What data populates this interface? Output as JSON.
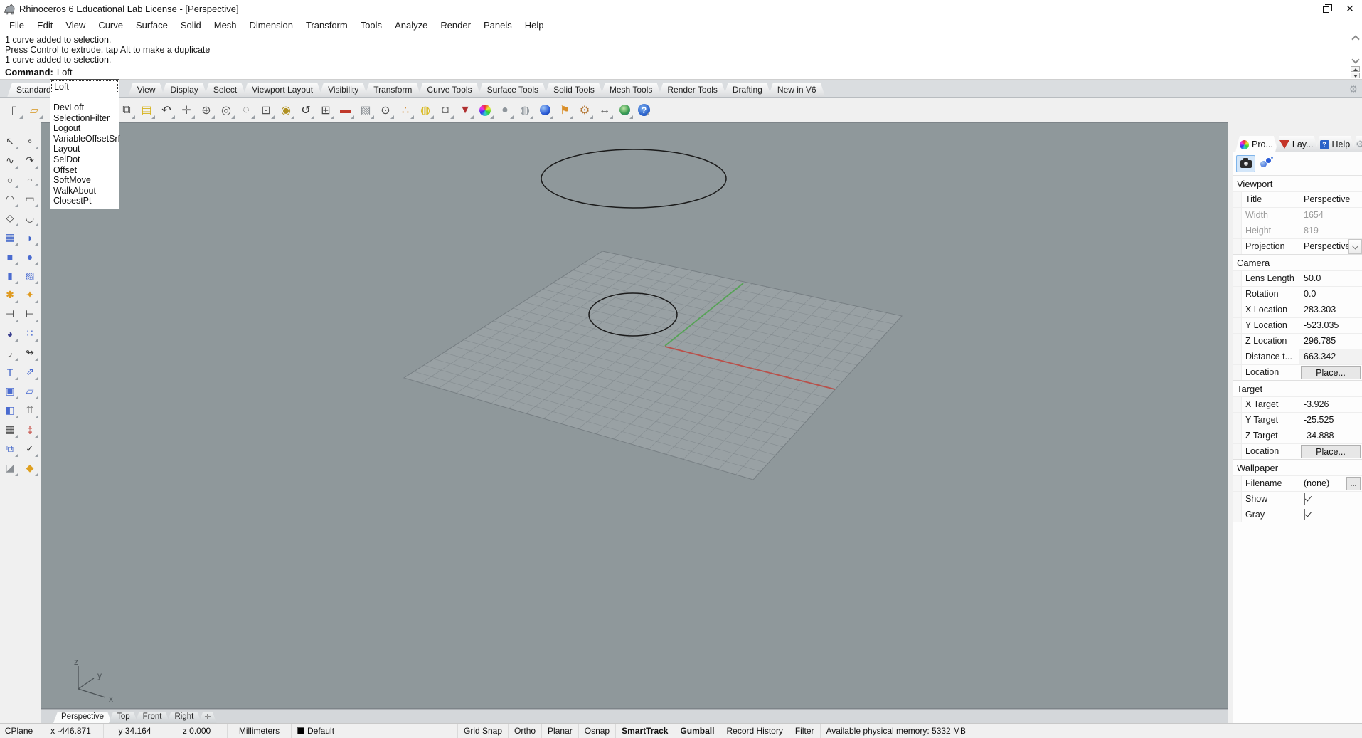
{
  "window": {
    "title": "Rhinoceros 6 Educational Lab License - [Perspective]"
  },
  "menu": {
    "items": [
      "File",
      "Edit",
      "View",
      "Curve",
      "Surface",
      "Solid",
      "Mesh",
      "Dimension",
      "Transform",
      "Tools",
      "Analyze",
      "Render",
      "Panels",
      "Help"
    ]
  },
  "command": {
    "history": [
      "1 curve added to selection.",
      "Press Control to extrude, tap Alt to make a duplicate",
      "1 curve added to selection."
    ],
    "prompt_label": "Command:",
    "prompt_value": "Loft"
  },
  "autocomplete": {
    "selected": "Loft",
    "items": [
      "DevLoft",
      "SelectionFilter",
      "Logout",
      "VariableOffsetSrf",
      "Layout",
      "SelDot",
      "Offset",
      "SoftMove",
      "WalkAbout",
      "ClosestPt"
    ]
  },
  "ribbon": {
    "first": "Standard",
    "tabs": [
      "View",
      "Display",
      "Select",
      "Viewport Layout",
      "Visibility",
      "Transform",
      "Curve Tools",
      "Surface Tools",
      "Solid Tools",
      "Mesh Tools",
      "Render Tools",
      "Drafting",
      "New in V6"
    ]
  },
  "main_toolbar": {
    "left_icons": [
      {
        "name": "new-file-icon",
        "glyph": "▯",
        "color": "#555"
      },
      {
        "name": "open-file-icon",
        "glyph": "▱",
        "color": "#d9a23a"
      }
    ],
    "icons": [
      {
        "name": "copy-icon",
        "glyph": "⧉",
        "color": "#555"
      },
      {
        "name": "paste-icon",
        "glyph": "▤",
        "color": "#d6b21c"
      },
      {
        "name": "undo-icon",
        "glyph": "↶",
        "color": "#333"
      },
      {
        "name": "pan-icon",
        "glyph": "✛",
        "color": "#555"
      },
      {
        "name": "rotate-view-icon",
        "glyph": "⊕",
        "color": "#555"
      },
      {
        "name": "zoom-extents-icon",
        "glyph": "◎",
        "color": "#555"
      },
      {
        "name": "zoom-dynamic-icon",
        "glyph": "◌",
        "color": "#555"
      },
      {
        "name": "zoom-window-icon",
        "glyph": "⊡",
        "color": "#555"
      },
      {
        "name": "zoom-selected-icon",
        "glyph": "◉",
        "color": "#b09020"
      },
      {
        "name": "undo-view-change-icon",
        "glyph": "↺",
        "color": "#333"
      },
      {
        "name": "viewport-layout-icon",
        "glyph": "⊞",
        "color": "#444"
      },
      {
        "name": "display-mode-icon",
        "glyph": "▬",
        "color": "#c0392b"
      },
      {
        "name": "surface-analysis-icon",
        "glyph": "▧",
        "color": "#8a8f94"
      },
      {
        "name": "radius-measure-icon",
        "glyph": "⊙",
        "color": "#555"
      },
      {
        "name": "object-snap-icon",
        "glyph": "∴",
        "color": "#d08020"
      },
      {
        "name": "lamp-icon",
        "glyph": "◍",
        "color": "#d8b81c"
      },
      {
        "name": "lock-icon",
        "glyph": "◘",
        "color": "#777"
      },
      {
        "name": "render-icon",
        "glyph": "▼",
        "color": "#b03030"
      },
      {
        "name": "color-wheel-icon",
        "glyph": "",
        "cls": "colorwheel"
      },
      {
        "name": "shaded-sphere-icon",
        "glyph": "●",
        "color": "#8f969c"
      },
      {
        "name": "ghosted-sphere-icon",
        "glyph": "◍",
        "color": "#8f969c"
      },
      {
        "name": "rendered-sphere-icon",
        "glyph": "",
        "cls": "bluesphere"
      },
      {
        "name": "flag-icon",
        "glyph": "⚑",
        "color": "#d98f2a"
      },
      {
        "name": "options-gears-icon",
        "glyph": "⚙",
        "color": "#b06f28"
      },
      {
        "name": "dimension-icon",
        "glyph": "↔",
        "color": "#444"
      },
      {
        "name": "earth-icon",
        "glyph": "",
        "cls": "earthico"
      },
      {
        "name": "help-icon",
        "glyph": "?",
        "cls": "helpico"
      }
    ]
  },
  "side_toolbar": {
    "icons": [
      {
        "name": "pointer-tool-icon",
        "glyph": "↖",
        "color": "#444"
      },
      {
        "name": "point-tool-icon",
        "glyph": "∘",
        "color": "#444"
      },
      {
        "name": "curve-points-tool-icon",
        "glyph": "∿",
        "color": "#444"
      },
      {
        "name": "curve-handles-tool-icon",
        "glyph": "↷",
        "color": "#444"
      },
      {
        "name": "circle-tool-icon",
        "glyph": "○",
        "color": "#444"
      },
      {
        "name": "ellipse-tool-icon",
        "glyph": "○",
        "color": "#444",
        "cls": "squish"
      },
      {
        "name": "arc-tool-icon",
        "glyph": "◠",
        "color": "#444"
      },
      {
        "name": "rectangle-tool-icon",
        "glyph": "▭",
        "color": "#444"
      },
      {
        "name": "polygon-tool-icon",
        "glyph": "◇",
        "color": "#444"
      },
      {
        "name": "blend-curve-tool-icon",
        "glyph": "◡",
        "color": "#444"
      },
      {
        "name": "surface-points-tool-icon",
        "glyph": "▦",
        "color": "#3f64c8"
      },
      {
        "name": "patch-surface-tool-icon",
        "glyph": "◗",
        "color": "#3f64c8"
      },
      {
        "name": "box-tool-icon",
        "glyph": "■",
        "color": "#4a6bd0"
      },
      {
        "name": "sphere-tool-icon",
        "glyph": "●",
        "color": "#4a6bd0"
      },
      {
        "name": "cylinder-tool-icon",
        "glyph": "▮",
        "color": "#4a6bd0"
      },
      {
        "name": "surface-grid-tool-icon",
        "glyph": "▨",
        "color": "#4a6bd0"
      },
      {
        "name": "boolean-tool-icon",
        "glyph": "✱",
        "color": "#df9a20"
      },
      {
        "name": "explode-tool-icon",
        "glyph": "✦",
        "color": "#df9a20"
      },
      {
        "name": "trim-tool-icon",
        "glyph": "⊣",
        "color": "#444"
      },
      {
        "name": "split-tool-icon",
        "glyph": "⊢",
        "color": "#444"
      },
      {
        "name": "color-tool-icon",
        "glyph": "◕",
        "color": "#3a3f8f"
      },
      {
        "name": "point-set-tool-icon",
        "glyph": "∷",
        "color": "#4a6bd0"
      },
      {
        "name": "fillet-tool-icon",
        "glyph": "◞",
        "color": "#444"
      },
      {
        "name": "continuity-tool-icon",
        "glyph": "↬",
        "color": "#444"
      },
      {
        "name": "text-tool-icon",
        "glyph": "T",
        "color": "#3f64c8"
      },
      {
        "name": "scale-tool-icon",
        "glyph": "⇗",
        "color": "#4a6bd0"
      },
      {
        "name": "arrange-tool-icon",
        "glyph": "▣",
        "color": "#4a6bd0"
      },
      {
        "name": "align-tool-icon",
        "glyph": "▱",
        "color": "#4a6bd0"
      },
      {
        "name": "save-tool-icon",
        "glyph": "◧",
        "color": "#4a6bd0"
      },
      {
        "name": "extrude-tool-icon",
        "glyph": "⇈",
        "color": "#888"
      },
      {
        "name": "array-tool-icon",
        "glyph": "▦",
        "color": "#444"
      },
      {
        "name": "section-tool-icon",
        "glyph": "‡",
        "color": "#c23b32"
      },
      {
        "name": "offset-copy-tool-icon",
        "glyph": "⧉",
        "color": "#3f64c8"
      },
      {
        "name": "check-tool-icon",
        "glyph": "✓",
        "color": "#222"
      },
      {
        "name": "solid-tools-icon",
        "glyph": "◪",
        "color": "#8a8f94"
      },
      {
        "name": "pyramid-tool-icon",
        "glyph": "◆",
        "color": "#dfa020"
      }
    ]
  },
  "viewport": {
    "colors": {
      "bg": "#8f989b",
      "grid_line": "#6f777c",
      "x_axis": "#b9504a",
      "y_axis": "#57a257",
      "curve": "#1b1b1b",
      "gnomon": "#4c5357"
    },
    "axis": {
      "x": "x",
      "y": "y",
      "z": "z"
    }
  },
  "viewport_tabs": {
    "items": [
      {
        "label": "Perspective",
        "active": true,
        "name": "viewport-tab-perspective"
      },
      {
        "label": "Top",
        "name": "viewport-tab-top"
      },
      {
        "label": "Front",
        "name": "viewport-tab-front"
      },
      {
        "label": "Right",
        "name": "viewport-tab-right"
      }
    ],
    "add_label": "✛"
  },
  "panel": {
    "tabs": [
      {
        "label": "Pro...",
        "name": "panel-tab-properties",
        "cls": "pt-prop",
        "active": true
      },
      {
        "label": "Lay...",
        "name": "panel-tab-layers",
        "cls": "pt-lay"
      },
      {
        "label": "Help",
        "name": "panel-tab-help",
        "cls": "pt-help",
        "icon_glyph": "?"
      }
    ],
    "viewport": {
      "title": "Viewport",
      "rows": {
        "title": {
          "label": "Title",
          "value": "Perspective"
        },
        "width": {
          "label": "Width",
          "value": "1654"
        },
        "height": {
          "label": "Height",
          "value": "819"
        },
        "projection": {
          "label": "Projection",
          "value": "Perspective"
        }
      }
    },
    "camera": {
      "title": "Camera",
      "rows": {
        "lens": {
          "label": "Lens Length",
          "value": "50.0"
        },
        "rotation": {
          "label": "Rotation",
          "value": "0.0"
        },
        "xloc": {
          "label": "X Location",
          "value": "283.303"
        },
        "yloc": {
          "label": "Y Location",
          "value": "-523.035"
        },
        "zloc": {
          "label": "Z Location",
          "value": "296.785"
        },
        "dist": {
          "label": "Distance t...",
          "value": "663.342"
        },
        "loc": {
          "label": "Location",
          "button": "Place..."
        }
      }
    },
    "target": {
      "title": "Target",
      "rows": {
        "xt": {
          "label": "X Target",
          "value": "-3.926"
        },
        "yt": {
          "label": "Y Target",
          "value": "-25.525"
        },
        "zt": {
          "label": "Z Target",
          "value": "-34.888"
        },
        "loc": {
          "label": "Location",
          "button": "Place..."
        }
      }
    },
    "wallpaper": {
      "title": "Wallpaper",
      "rows": {
        "filename": {
          "label": "Filename",
          "value": "(none)",
          "browse": "..."
        },
        "show": {
          "label": "Show"
        },
        "gray": {
          "label": "Gray"
        }
      }
    }
  },
  "statusbar": {
    "cplane": "CPlane",
    "x": "x -446.871",
    "y": "y 34.164",
    "z": "z 0.000",
    "units": "Millimeters",
    "layer": "Default",
    "toggles": [
      {
        "label": "Grid Snap",
        "name": "toggle-grid-snap"
      },
      {
        "label": "Ortho",
        "name": "toggle-ortho"
      },
      {
        "label": "Planar",
        "name": "toggle-planar"
      },
      {
        "label": "Osnap",
        "name": "toggle-osnap"
      },
      {
        "label": "SmartTrack",
        "bold": true,
        "name": "toggle-smarttrack"
      },
      {
        "label": "Gumball",
        "bold": true,
        "name": "toggle-gumball"
      },
      {
        "label": "Record History",
        "name": "toggle-record-history"
      },
      {
        "label": "Filter",
        "name": "toggle-filter"
      }
    ],
    "memory": "Available physical memory: 5332 MB"
  }
}
